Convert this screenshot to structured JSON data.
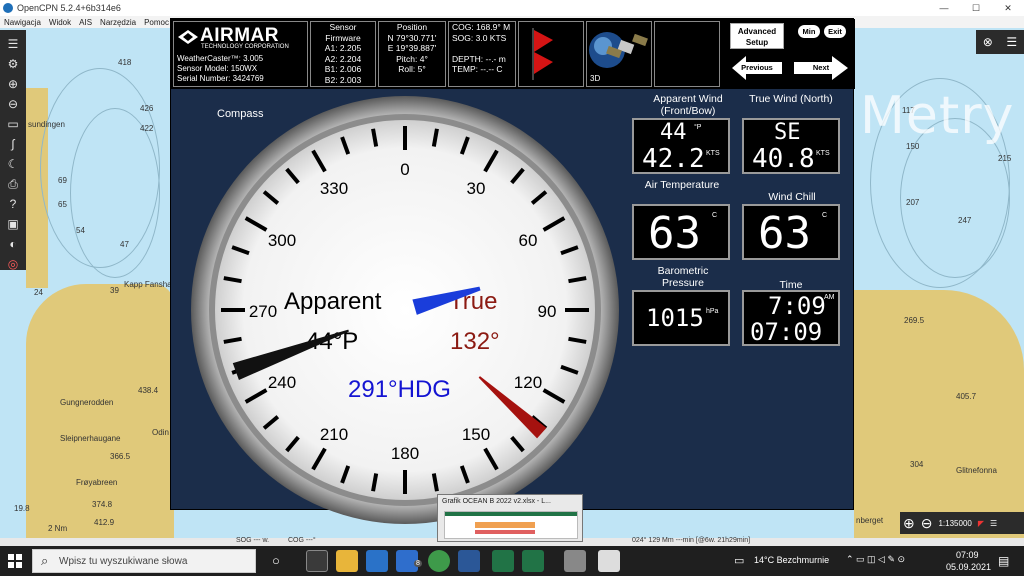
{
  "window": {
    "title": "OpenCPN 5.2.4+6b314e6",
    "minimize": "—",
    "maximize": "☐",
    "close": "✕"
  },
  "menu": [
    "Nawigacja",
    "Widok",
    "AIS",
    "Narzędzia",
    "Pomoc"
  ],
  "chart": {
    "depths": [
      "418",
      "426",
      "422",
      "176",
      "171",
      "69",
      "65",
      "54",
      "54",
      "47",
      "39",
      "24",
      "66",
      "150",
      "117",
      "207",
      "215",
      "247",
      "269.5",
      "405.7",
      "304",
      "66",
      "34",
      "19",
      "17",
      "30"
    ],
    "place_names": [
      "Kapp Fanshaw",
      "Gungnerodden",
      "Sleipnerhaugane",
      "Frøyabreen",
      "Odin",
      "Glitnefonna",
      "nberget",
      "sundingen"
    ],
    "heights": [
      "438.4",
      "366.5",
      "374.8",
      "412.9",
      "19.8"
    ],
    "scale_label": "2 Nm",
    "watermark": "Metry"
  },
  "header": {
    "brand": "AIRMAR",
    "corp": "TECHNOLOGY CORPORATION",
    "model_line1": "WeatherCaster™: 3.005",
    "model_line2": "Sensor Model:  150WX",
    "model_line3": "Serial Number: 3424769",
    "firmware": [
      "Sensor",
      "Firmware",
      "A1: 2.205",
      "A2: 2.204",
      "B1: 2.006",
      "B2: 2.003"
    ],
    "position": [
      "Position",
      "N 79°30.771'",
      "E 19°39.887'",
      "Pitch: 4°",
      "Roll: 5°"
    ],
    "cog": [
      "COG: 168.9° M",
      "SOG: 3.0 KTS",
      "",
      "DEPTH: --.- m",
      "TEMP: --.-- C"
    ],
    "label_3d": "3D",
    "advanced_setup": "Advanced Setup",
    "min": "Min",
    "exit": "Exit",
    "previous": "Previous",
    "next": "Next"
  },
  "compass": {
    "label": "Compass",
    "ticks": [
      "0",
      "30",
      "60",
      "90",
      "120",
      "150",
      "180",
      "210",
      "240",
      "270",
      "300",
      "330"
    ],
    "apparent_label": "Apparent",
    "apparent_value": "44°P",
    "apparent_angle": 44,
    "apparent_side": "port",
    "true_label": "True",
    "true_value": "132°",
    "true_angle": 132,
    "heading_text": "291°HDG",
    "heading": 291
  },
  "tiles": {
    "apparent_wind_label": "Apparent Wind (Front/Bow)",
    "apparent_wind_dir": "44",
    "apparent_wind_dir_unit": "°P",
    "apparent_wind_speed": "42.2",
    "apparent_wind_speed_unit": "KTS",
    "true_wind_label": "True Wind (North)",
    "true_wind_dir": "SE",
    "true_wind_speed": "40.8",
    "true_wind_speed_unit": "KTS",
    "air_temp_label": "Air Temperature",
    "air_temp": "63",
    "air_temp_unit": "C",
    "wind_chill_label": "Wind Chill",
    "wind_chill": "63",
    "wind_chill_unit": "C",
    "baro_label": "Barometric Pressure",
    "baro": "1015",
    "baro_unit": "hPa",
    "time_label": "Time",
    "time": "7:09",
    "time_ampm": "AM",
    "date": "07:09"
  },
  "status": {
    "sog": "SOG --- w.",
    "cog": "COG ---°",
    "cursor": "024°  129 Mm ---min [@6w. 21h29min]",
    "scale": "1:135000"
  },
  "preview": {
    "title": "Grafik OCEAN B 2022 v2.xlsx - L..."
  },
  "taskbar": {
    "search_placeholder": "Wpisz tu wyszukiwane słowa",
    "weather": "14°C  Bezchmurnie",
    "clock_time": "07:09",
    "clock_date": "05.09.2021",
    "badge": "8"
  },
  "colors": {
    "panel_bg": "#1b2d4a",
    "apparent_needle": "#111111",
    "true_needle": "#a5120f",
    "heading_text": "#1414d2",
    "true_text": "#8b1a12",
    "heading_marker": "#1a3ddb",
    "land": "#e0c97a",
    "sea": "#bfe4f5"
  }
}
